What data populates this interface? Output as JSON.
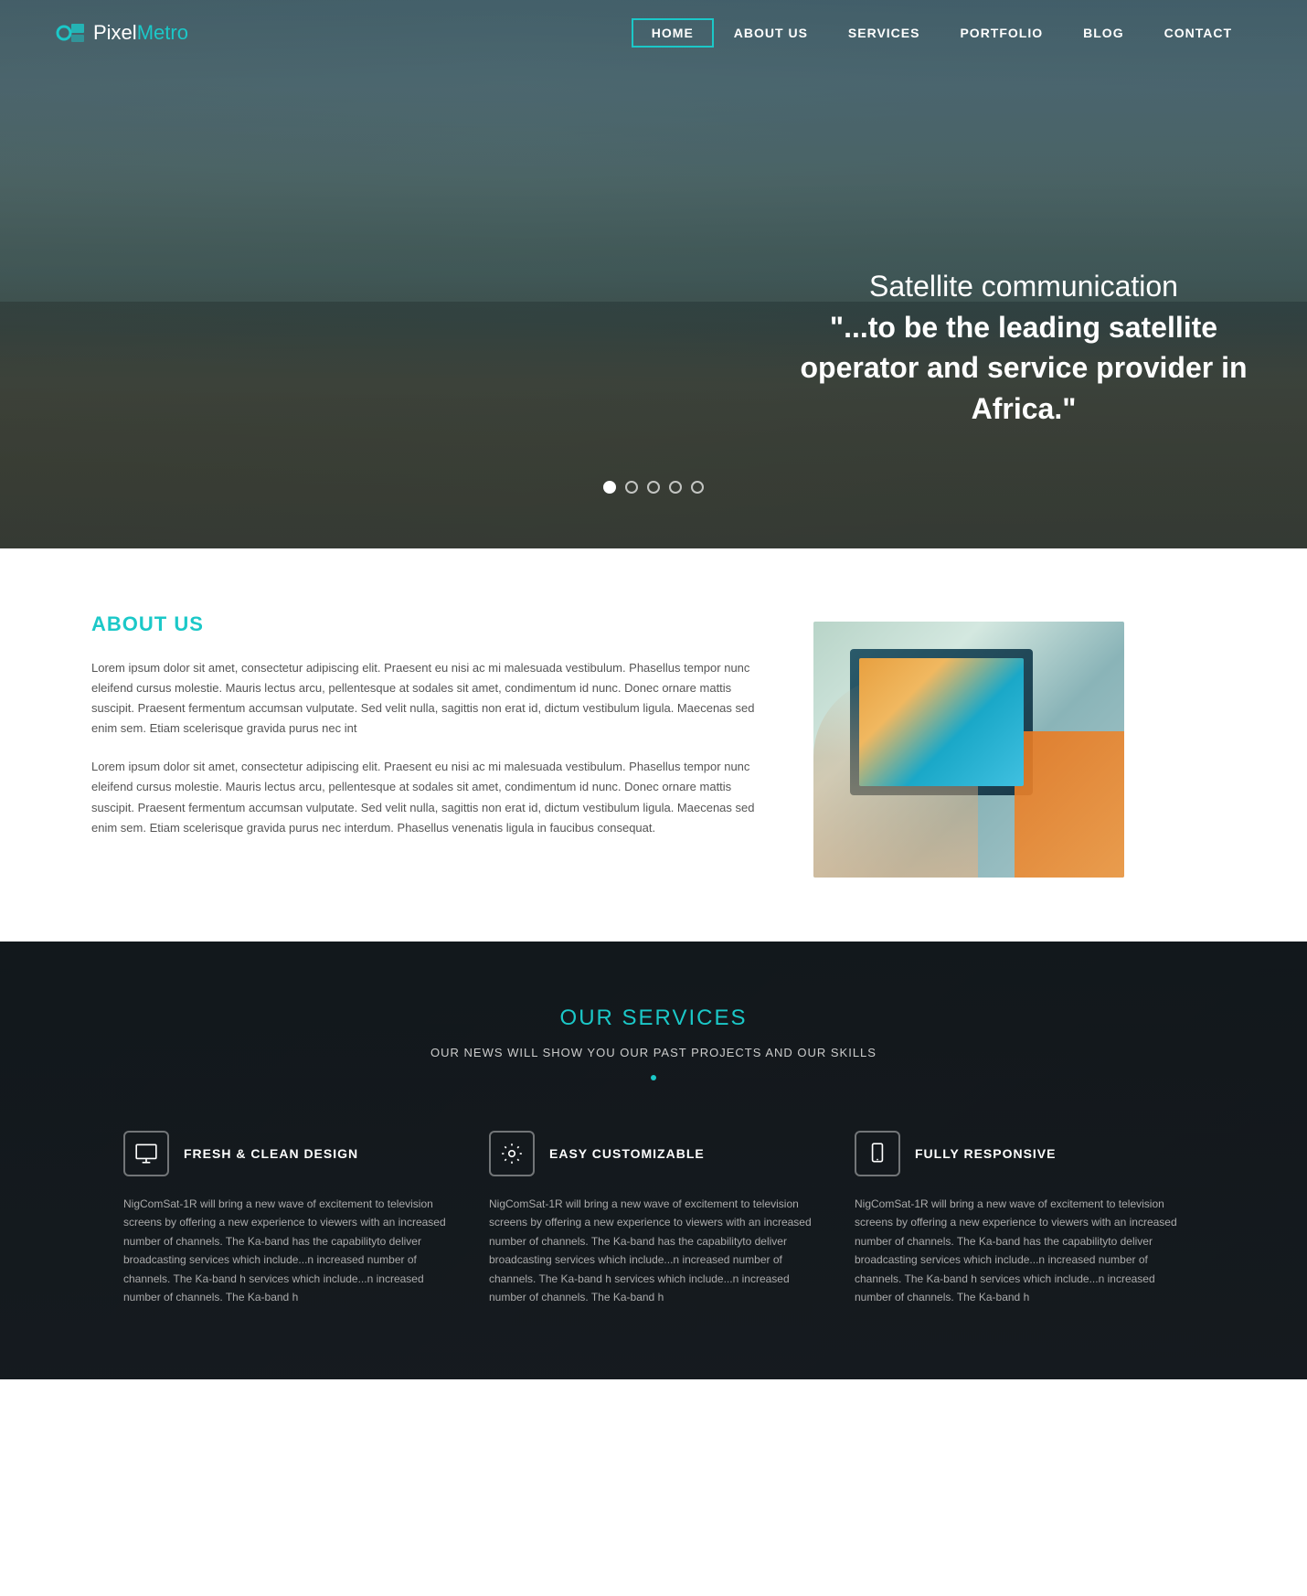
{
  "logo": {
    "pixel": "Pixel",
    "metro": "Metro",
    "icon": "pixel-icon"
  },
  "nav": {
    "items": [
      {
        "label": "HOME",
        "active": true
      },
      {
        "label": "ABOUT US",
        "active": false
      },
      {
        "label": "SERVICES",
        "active": false
      },
      {
        "label": "PORTFOLIO",
        "active": false
      },
      {
        "label": "BLOG",
        "active": false
      },
      {
        "label": "CONTACT",
        "active": false
      }
    ]
  },
  "hero": {
    "line1": "Satellite communication",
    "line2": "\"...to be the leading satellite",
    "line3": "operator and service provider in Africa.\"",
    "dots_count": 5,
    "active_dot": 0
  },
  "about": {
    "heading": "ABOUT US",
    "para1": "Lorem ipsum dolor sit amet, consectetur adipiscing elit. Praesent eu nisi ac mi malesuada vestibulum. Phasellus tempor nunc eleifend cursus molestie. Mauris lectus arcu, pellentesque at sodales sit amet, condimentum id nunc. Donec ornare mattis suscipit. Praesent fermentum accumsan vulputate. Sed velit nulla, sagittis non erat id, dictum vestibulum ligula. Maecenas sed enim sem. Etiam scelerisque gravida purus nec int",
    "para2": "Lorem ipsum dolor sit amet, consectetur adipiscing elit. Praesent eu nisi ac mi malesuada vestibulum. Phasellus tempor nunc eleifend cursus molestie. Mauris lectus arcu, pellentesque at sodales sit amet, condimentum id nunc. Donec ornare mattis suscipit. Praesent fermentum accumsan vulputate. Sed velit nulla, sagittis non erat id, dictum vestibulum ligula. Maecenas sed enim sem. Etiam scelerisque gravida purus nec interdum. Phasellus venenatis ligula in faucibus consequat."
  },
  "services": {
    "heading": "OUR SERVICES",
    "subheading": "OUR NEWS WILL SHOW YOU OUR PAST PROJECTS AND OUR SKILLS",
    "cards": [
      {
        "icon": "monitor-icon",
        "title": "FRESH & CLEAN DESIGN",
        "desc": "NigComSat-1R will bring a new wave of excitement to television screens by offering a new experience to viewers with an increased number of channels. The Ka-band has the capabilityto deliver broadcasting services which include...n increased number of channels. The Ka-band h services which include...n increased number of channels. The Ka-band h"
      },
      {
        "icon": "gear-icon",
        "title": "EASY CUSTOMIZABLE",
        "desc": "NigComSat-1R will bring a new wave of excitement to television screens by offering a new experience to viewers with an increased number of channels. The Ka-band has the capabilityto deliver broadcasting services which include...n increased number of channels. The Ka-band h services which include...n increased number of channels. The Ka-band h"
      },
      {
        "icon": "mobile-icon",
        "title": "FULLY RESPONSIVE",
        "desc": "NigComSat-1R will bring a new wave of excitement to television screens by offering a new experience to viewers with an increased number of channels. The Ka-band has the capabilityto deliver broadcasting services which include...n increased number of channels. The Ka-band h services which include...n increased number of channels. The Ka-band h"
      }
    ]
  }
}
